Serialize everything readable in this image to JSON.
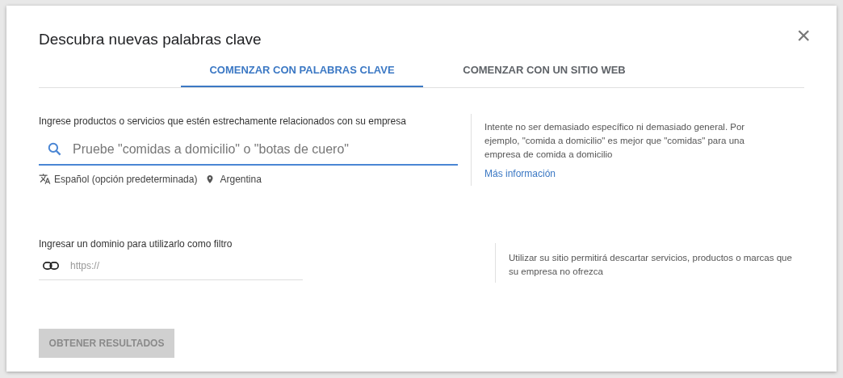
{
  "dialog": {
    "title": "Descubra nuevas palabras clave",
    "close": "×"
  },
  "tabs": [
    {
      "label": "COMENZAR CON PALABRAS CLAVE",
      "selected": true
    },
    {
      "label": "COMENZAR CON UN SITIO WEB",
      "selected": false
    }
  ],
  "keywords": {
    "label": "Ingrese productos o servicios que estén estrechamente relacionados con su empresa",
    "placeholder": "Pruebe \"comidas a domicilio\" o \"botas de cuero\"",
    "language": "Español (opción predeterminada)",
    "location": "Argentina",
    "hint": "Intente no ser demasiado específico ni demasiado general. Por ejemplo, \"comida a domicilio\" es mejor que \"comidas\" para una empresa de comida a domicilio",
    "link": "Más información"
  },
  "domain": {
    "label": "Ingresar un dominio para utilizarlo como filtro",
    "placeholder": "https://",
    "hint": "Utilizar su sitio permitirá descartar servicios, productos o marcas que su empresa no ofrezca"
  },
  "submit": {
    "label": "OBTENER RESULTADOS",
    "disabled": true
  }
}
